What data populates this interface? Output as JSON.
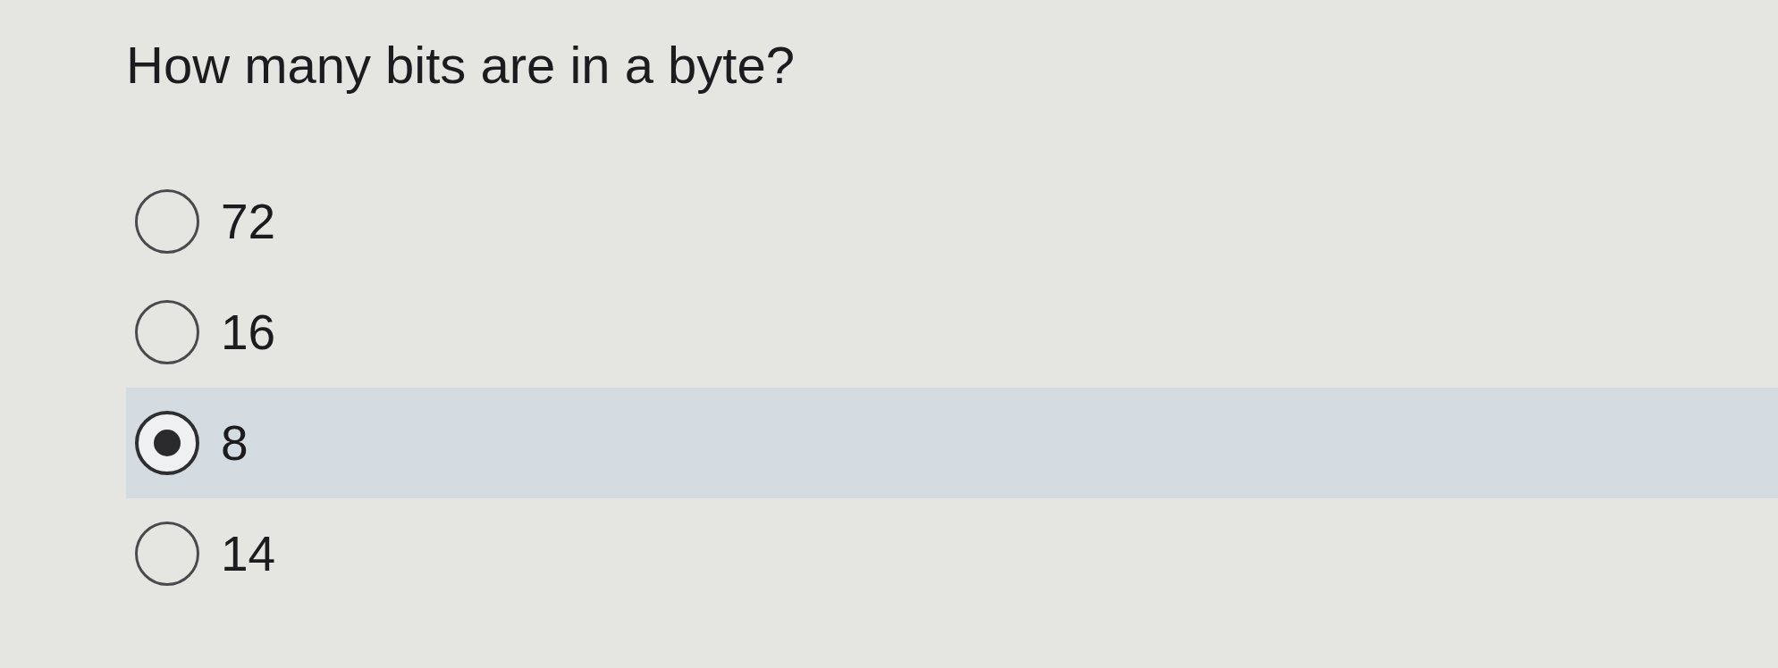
{
  "question": "How many bits are in a byte?",
  "options": [
    {
      "label": "72",
      "selected": false
    },
    {
      "label": "16",
      "selected": false
    },
    {
      "label": "8",
      "selected": true
    },
    {
      "label": "14",
      "selected": false
    }
  ]
}
